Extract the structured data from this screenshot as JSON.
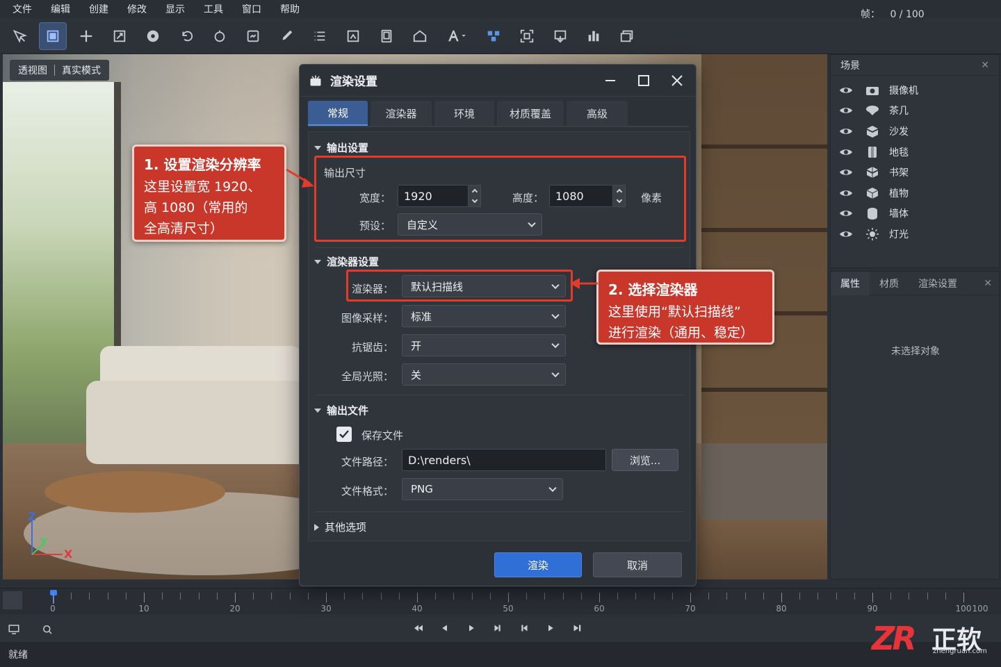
{
  "menu": [
    "文件",
    "编辑",
    "创建",
    "修改",
    "显示",
    "工具",
    "窗口",
    "帮助"
  ],
  "toolbar_icons": [
    "select-icon",
    "render-view-icon",
    "move-icon",
    "scale-icon",
    "record-icon",
    "undo-rotate-icon",
    "sphere-icon",
    "render-region-icon",
    "brush-icon",
    "list-icon",
    "image-edit-icon",
    "frame-icon",
    "house-icon",
    "text-icon",
    "cubes-icon",
    "fit-view-icon",
    "export-icon",
    "chart-icon",
    "window-icon"
  ],
  "viewport": {
    "view_label": "透视图",
    "mode_label": "真实模式",
    "axis_x": "X",
    "axis_y": "Y",
    "axis_z": "Z"
  },
  "scene": {
    "title": "场景",
    "close": "✕",
    "items": [
      {
        "label": "摄像机",
        "icon": "camera-icon"
      },
      {
        "label": "茶几",
        "icon": "table-icon"
      },
      {
        "label": "沙发",
        "icon": "sofa-icon"
      },
      {
        "label": "地毯",
        "icon": "rug-icon"
      },
      {
        "label": "书架",
        "icon": "shelf-icon"
      },
      {
        "label": "植物",
        "icon": "plant-icon"
      },
      {
        "label": "墙体",
        "icon": "wall-icon"
      },
      {
        "label": "灯光",
        "icon": "light-icon"
      }
    ]
  },
  "props": {
    "tabs": [
      "属性",
      "材质",
      "渲染设置"
    ],
    "close": "✕",
    "empty": "未选择对象"
  },
  "dialog": {
    "title": "渲染设置",
    "tabs": [
      "常规",
      "渲染器",
      "环境",
      "材质覆盖",
      "高级"
    ],
    "output_section": "输出设置",
    "output_size": "输出尺寸",
    "width_label": "宽度：",
    "width_value": "1920",
    "height_label": "高度：",
    "height_value": "1080",
    "unit": "像素",
    "preset_label": "预设：",
    "preset_value": "自定义",
    "renderer_section": "渲染器设置",
    "renderer_label": "渲染器：",
    "renderer_value": "默认扫描线",
    "sampling_label": "图像采样：",
    "sampling_value": "标准",
    "aa_label": "抗锯齿：",
    "aa_value": "开",
    "gi_label": "全局光照：",
    "gi_value": "关",
    "file_section": "输出文件",
    "save_file": "保存文件",
    "save_checked": true,
    "path_label": "文件路径：",
    "path_value": "D:\\renders\\",
    "browse": "浏览...",
    "format_label": "文件格式：",
    "format_value": "PNG",
    "other_section": "其他选项",
    "render_btn": "渲染",
    "cancel_btn": "取消"
  },
  "callouts": {
    "one_title": "1. 设置渲染分辨率",
    "one_lines": [
      "这里设置宽 1920、",
      "高 1080（常用的",
      "全高清尺寸）"
    ],
    "two_title": "2. 选择渲染器",
    "two_lines": [
      "这里使用“默认扫描线”",
      "进行渲染（通用、稳定）"
    ]
  },
  "timeline": {
    "labels": [
      "0",
      "10",
      "20",
      "30",
      "40",
      "50",
      "60",
      "70",
      "80",
      "90",
      "100",
      "100"
    ],
    "current_frame": 0
  },
  "status": {
    "text": "就绪",
    "frame_label": "帧：",
    "frame_value": "0 / 100"
  },
  "logo": {
    "mark": "ZR",
    "name": "正软",
    "site": "zhengruan.com"
  },
  "colors": {
    "accent": "#2f6fd6",
    "highlight": "#e23a2b",
    "callout": "#c9372b"
  }
}
